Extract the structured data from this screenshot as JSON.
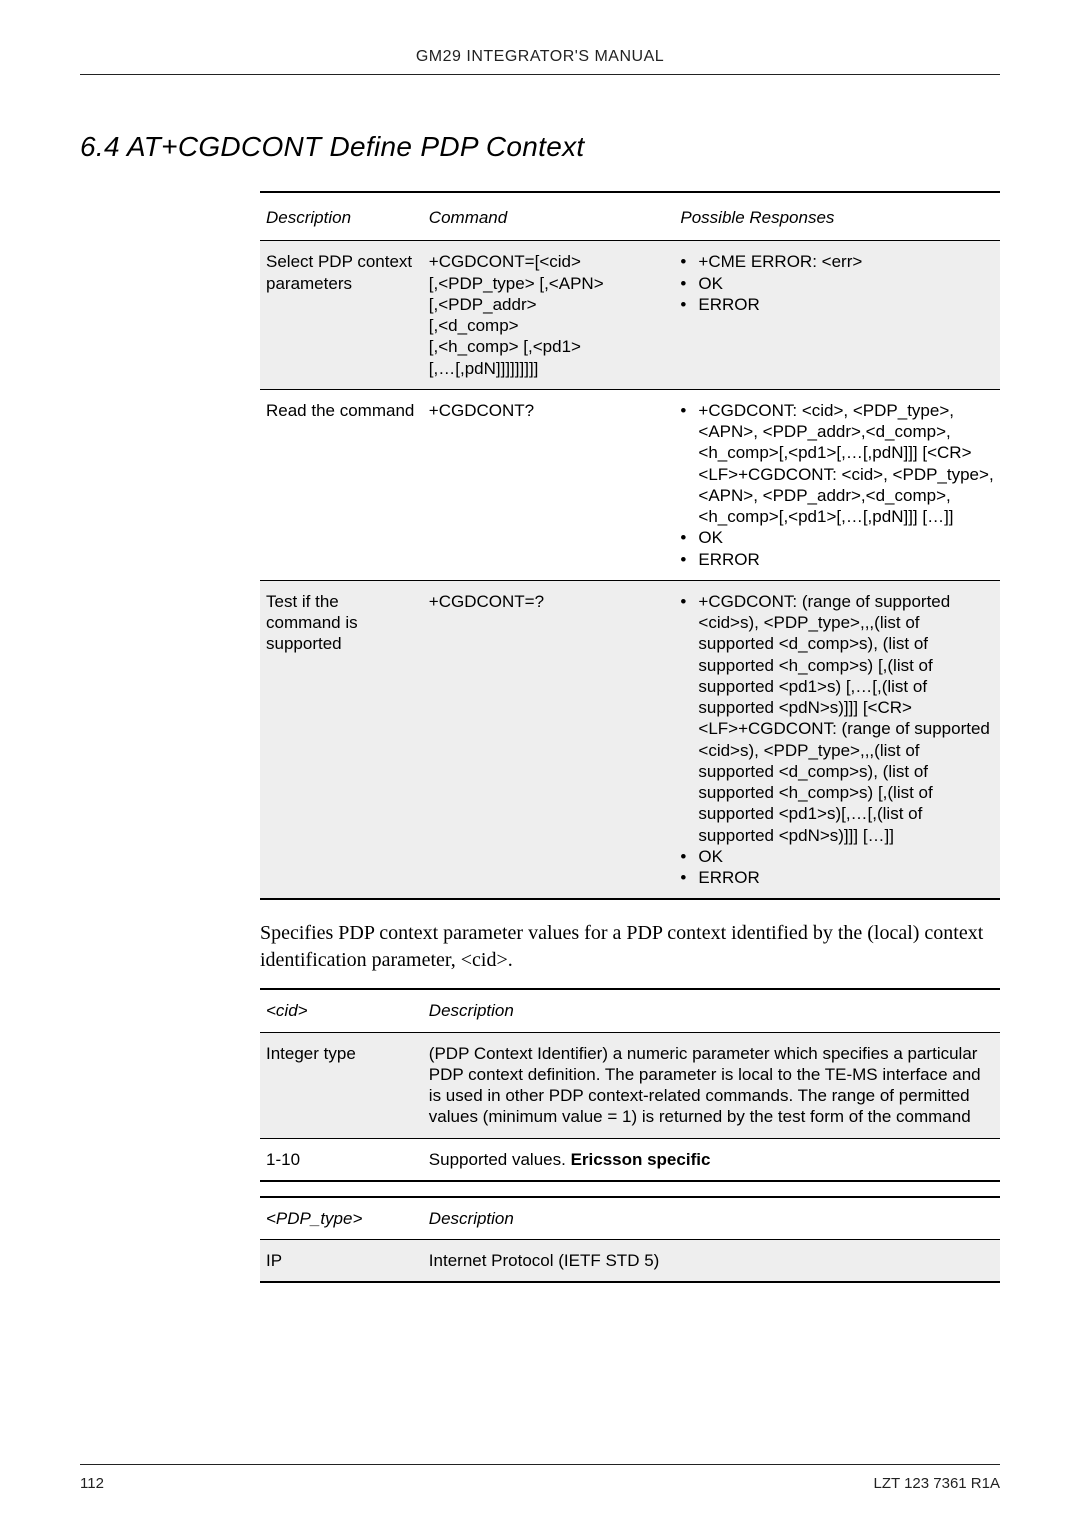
{
  "header": "GM29 INTEGRATOR'S MANUAL",
  "section_title": "6.4 AT+CGDCONT  Define PDP Context",
  "table1": {
    "headers": {
      "c1": "Description",
      "c2": "Command",
      "c3": "Possible Responses"
    },
    "rows": [
      {
        "alt": true,
        "c1": "Select PDP context parameters",
        "c2": "+CGDCONT=[<cid>\n[,<PDP_type> [,<APN>\n[,<PDP_addr>\n[,<d_comp>\n[,<h_comp> [,<pd1>\n[,…[,pdN]]]]]]]]]",
        "resp": [
          "+CME ERROR: <err>",
          "OK",
          "ERROR"
        ]
      },
      {
        "alt": false,
        "c1": "Read the command",
        "c2": "+CGDCONT?",
        "resp": [
          "+CGDCONT: <cid>, <PDP_type>,<APN>, <PDP_addr>,<d_comp>, <h_comp>[,<pd1>[,…[,pdN]]] [<CR><LF>+CGDCONT: <cid>, <PDP_type>,<APN>, <PDP_addr>,<d_comp>, <h_comp>[,<pd1>[,…[,pdN]]] […]]",
          "OK",
          "ERROR"
        ]
      },
      {
        "alt": true,
        "last": true,
        "c1": "Test if the command is supported",
        "c2": "+CGDCONT=?",
        "resp": [
          "+CGDCONT: (range of supported <cid>s), <PDP_type>,,,(list of supported <d_comp>s), (list of supported <h_comp>s) [,(list of supported <pd1>s) [,…[,(list of supported <pdN>s)]]] [<CR><LF>+CGDCONT: (range of supported <cid>s), <PDP_type>,,,(list of supported <d_comp>s), (list of supported <h_comp>s) [,(list of supported <pd1>s)[,…[,(list of supported <pdN>s)]]] […]]",
          "OK",
          "ERROR"
        ]
      }
    ]
  },
  "paragraph": "Specifies PDP context parameter values for a PDP context identified by the (local) context identification parameter, <cid>.",
  "table2": {
    "headers": {
      "p1": "<cid>",
      "p2": "Description"
    },
    "rows": [
      {
        "alt": true,
        "c1": "Integer type",
        "c2": "(PDP Context Identifier) a numeric parameter which specifies a particular PDP context definition. The parameter is local to the TE-MS interface and is used in other PDP context-related commands. The range of permitted values (minimum value = 1) is returned by the test form of the command"
      },
      {
        "alt": false,
        "last": true,
        "c1": "1-10",
        "c2_prefix": "Supported values. ",
        "c2_bold": "Ericsson specific"
      }
    ]
  },
  "table3": {
    "headers": {
      "p1": "<PDP_type>",
      "p2": "Description"
    },
    "rows": [
      {
        "alt": true,
        "last": true,
        "c1": "IP",
        "c2": "Internet Protocol (IETF STD 5)"
      }
    ]
  },
  "footer": {
    "page": "112",
    "doc": "LZT 123 7361 R1A"
  }
}
